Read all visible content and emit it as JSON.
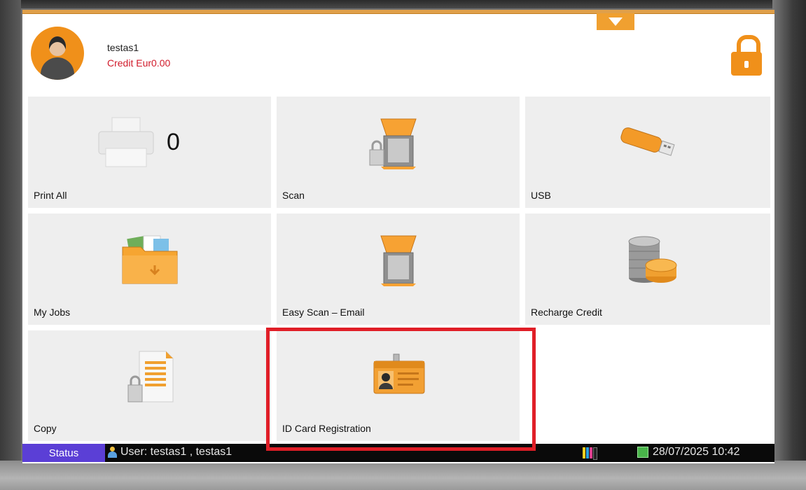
{
  "header": {
    "user_name": "testas1",
    "credit_text": "Credit Eur0.00"
  },
  "tiles": {
    "print_all": {
      "label": "Print All",
      "count": "0",
      "icon": "printer-icon"
    },
    "scan": {
      "label": "Scan",
      "icon": "scanner-lock-icon"
    },
    "usb": {
      "label": "USB",
      "icon": "usb-drive-icon"
    },
    "my_jobs": {
      "label": "My Jobs",
      "icon": "folder-icon"
    },
    "easy_scan": {
      "label": "Easy Scan – Email",
      "icon": "scanner-icon"
    },
    "recharge": {
      "label": "Recharge Credit",
      "icon": "coins-icon"
    },
    "copy": {
      "label": "Copy",
      "icon": "document-lock-icon"
    },
    "id_card": {
      "label": "ID Card Registration",
      "icon": "id-card-icon"
    }
  },
  "statusbar": {
    "status_label": "Status",
    "user_text": "User: testas1 , testas1",
    "datetime": "28/07/2025 10:42"
  },
  "colors": {
    "accent": "#f0901a",
    "highlight": "#e01e27",
    "status_button": "#5b3fd6",
    "credit": "#d11a2a"
  }
}
